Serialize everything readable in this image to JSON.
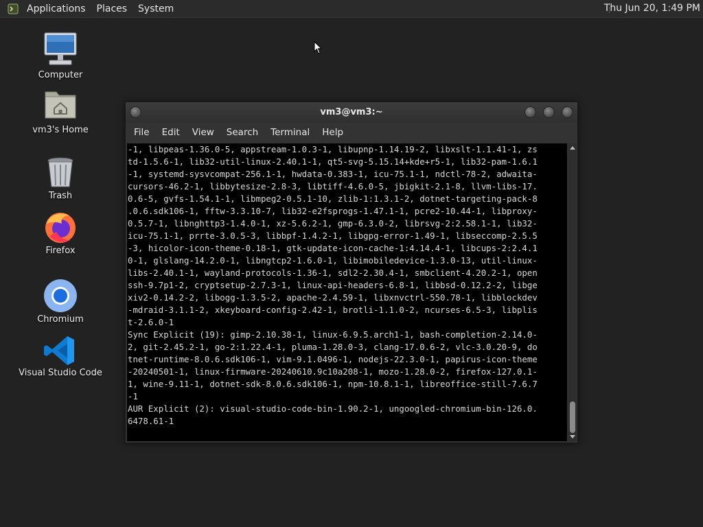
{
  "panel": {
    "menus": [
      "Applications",
      "Places",
      "System"
    ],
    "clock": "Thu Jun 20,  1:49 PM"
  },
  "desktop": {
    "icons": [
      {
        "label": "Computer",
        "icon": "computer-icon"
      },
      {
        "label": "vm3's Home",
        "icon": "home-folder-icon"
      },
      {
        "label": "Trash",
        "icon": "trash-icon"
      },
      {
        "label": "Firefox",
        "icon": "firefox-icon"
      },
      {
        "label": "Chromium",
        "icon": "chromium-icon"
      },
      {
        "label": "Visual Studio Code",
        "icon": "vscode-icon"
      }
    ]
  },
  "terminal": {
    "title": "vm3@vm3:~",
    "menus": [
      "File",
      "Edit",
      "View",
      "Search",
      "Terminal",
      "Help"
    ],
    "lines": [
      "-1, libpeas-1.36.0-5, appstream-1.0.3-1, libupnp-1.14.19-2, libxslt-1.1.41-1, zs",
      "td-1.5.6-1, lib32-util-linux-2.40.1-1, qt5-svg-5.15.14+kde+r5-1, lib32-pam-1.6.1",
      "-1, systemd-sysvcompat-256.1-1, hwdata-0.383-1, icu-75.1-1, ndctl-78-2, adwaita-",
      "cursors-46.2-1, libbytesize-2.8-3, libtiff-4.6.0-5, jbigkit-2.1-8, llvm-libs-17.",
      "0.6-5, gvfs-1.54.1-1, libmpeg2-0.5.1-10, zlib-1:1.3.1-2, dotnet-targeting-pack-8",
      ".0.6.sdk106-1, fftw-3.3.10-7, lib32-e2fsprogs-1.47.1-1, pcre2-10.44-1, libproxy-",
      "0.5.7-1, libnghttp3-1.4.0-1, xz-5.6.2-1, gmp-6.3.0-2, librsvg-2:2.58.1-1, lib32-",
      "icu-75.1-1, prrte-3.0.5-3, libbpf-1.4.2-1, libgpg-error-1.49-1, libseccomp-2.5.5",
      "-3, hicolor-icon-theme-0.18-1, gtk-update-icon-cache-1:4.14.4-1, libcups-2:2.4.1",
      "0-1, glslang-14.2.0-1, libngtcp2-1.6.0-1, libimobiledevice-1.3.0-13, util-linux-",
      "libs-2.40.1-1, wayland-protocols-1.36-1, sdl2-2.30.4-1, smbclient-4.20.2-1, open",
      "ssh-9.7p1-2, cryptsetup-2.7.3-1, linux-api-headers-6.8-1, libbsd-0.12.2-2, libge",
      "xiv2-0.14.2-2, libogg-1.3.5-2, apache-2.4.59-1, libxnvctrl-550.78-1, libblockdev",
      "-mdraid-3.1.1-2, xkeyboard-config-2.42-1, brotli-1.1.0-2, ncurses-6.5-3, libplis",
      "t-2.6.0-1",
      "Sync Explicit (19): gimp-2.10.38-1, linux-6.9.5.arch1-1, bash-completion-2.14.0-",
      "2, git-2.45.2-1, go-2:1.22.4-1, pluma-1.28.0-3, clang-17.0.6-2, vlc-3.0.20-9, do",
      "tnet-runtime-8.0.6.sdk106-1, vim-9.1.0496-1, nodejs-22.3.0-1, papirus-icon-theme",
      "-20240501-1, linux-firmware-20240610.9c10a208-1, mozo-1.28.0-2, firefox-127.0.1-",
      "1, wine-9.11-1, dotnet-sdk-8.0.6.sdk106-1, npm-10.8.1-1, libreoffice-still-7.6.7",
      "-1",
      "AUR Explicit (2): visual-studio-code-bin-1.90.2-1, ungoogled-chromium-bin-126.0.",
      "6478.61-1"
    ]
  }
}
